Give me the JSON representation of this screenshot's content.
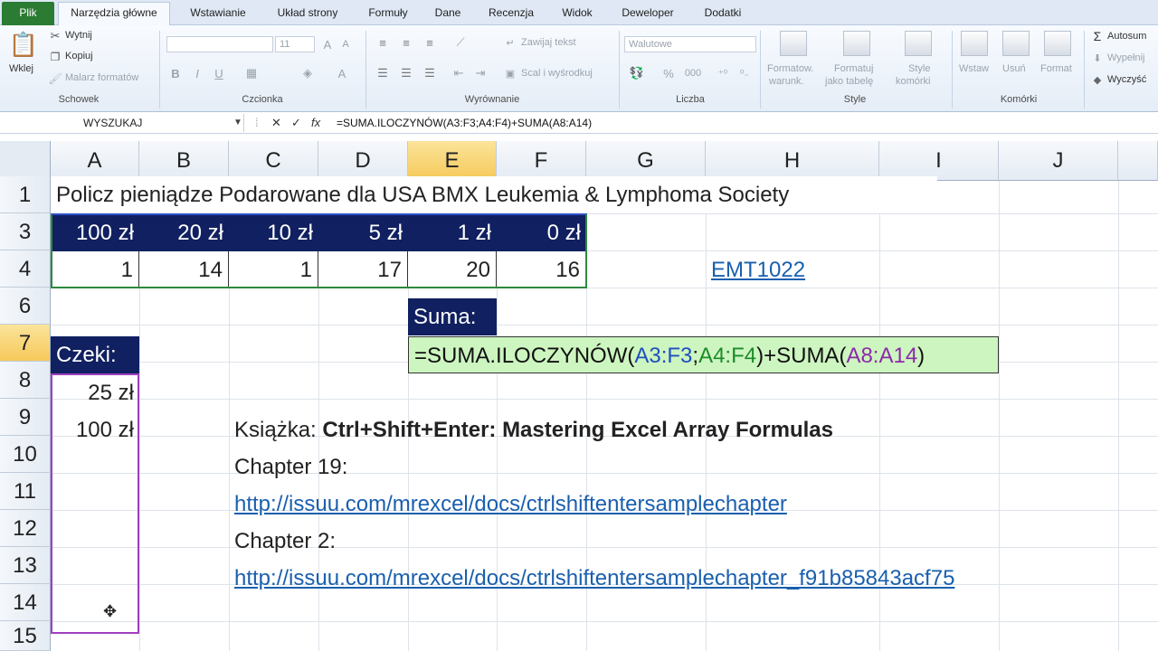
{
  "tabs": [
    "Plik",
    "Narzędzia główne",
    "Wstawianie",
    "Układ strony",
    "Formuły",
    "Dane",
    "Recenzja",
    "Widok",
    "Deweloper",
    "Dodatki"
  ],
  "ribbon": {
    "clipboard": {
      "paste": "Wklej",
      "cut": "Wytnij",
      "copy": "Kopiuj",
      "format_painter": "Malarz formatów",
      "label": "Schowek"
    },
    "font": {
      "size": "11",
      "label": "Czcionka",
      "bold": "B",
      "italic": "I",
      "underline": "U"
    },
    "alignment": {
      "wrap": "Zawijaj tekst",
      "merge": "Scal i wyśrodkuj",
      "label": "Wyrównanie"
    },
    "number": {
      "format": "Walutowe",
      "label": "Liczba",
      "percent": "%",
      "thousands": "000"
    },
    "styles": {
      "cond": "Formatow.",
      "cond2": "warunk.",
      "table": "Formatuj",
      "table2": "jako tabelę",
      "cell": "Style",
      "cell2": "komórki",
      "label": "Style"
    },
    "cells": {
      "insert": "Wstaw",
      "delete": "Usuń",
      "format": "Format",
      "label": "Komórki"
    },
    "editing": {
      "autosum": "Autosum",
      "fill": "Wypełnij",
      "clear": "Wyczyść"
    }
  },
  "formula_bar": {
    "name_box": "WYSZUKAJ",
    "cancel": "✕",
    "enter": "✓",
    "fx": "fx",
    "formula": "=SUMA.ILOCZYNÓW(A3:F3;A4:F4)+SUMA(A8:A14)"
  },
  "columns": [
    "A",
    "B",
    "C",
    "D",
    "E",
    "F",
    "G",
    "H",
    "I",
    "J"
  ],
  "rows": [
    "1",
    "3",
    "4",
    "6",
    "7",
    "8",
    "9",
    "10",
    "11",
    "12",
    "13",
    "14",
    "15"
  ],
  "sheet": {
    "title": "Policz pieniądze Podarowane dla USA BMX Leukemia & Lymphoma Society",
    "denominations": [
      "100 zł",
      "20 zł",
      "10 zł",
      "5 zł",
      "1 zł",
      "0 zł"
    ],
    "counts": [
      "1",
      "14",
      "1",
      "17",
      "20",
      "16"
    ],
    "emt": "EMT1022",
    "suma_label": "Suma:",
    "formula_parts": [
      "=SUMA.ILOCZYNÓW(",
      "A3:F3",
      ";",
      "A4:F4",
      ")+SUMA(",
      "A8:A14",
      ")"
    ],
    "czeki_label": "Czeki:",
    "checks": [
      "25 zł",
      "100 zł"
    ],
    "book_prefix": "Książka: ",
    "book_title": "Ctrl+Shift+Enter: Mastering Excel Array Formulas",
    "chapter19": "Chapter 19:",
    "link1": "http://issuu.com/mrexcel/docs/ctrlshiftentersamplechapter",
    "chapter2": "Chapter 2:",
    "link2": "http://issuu.com/mrexcel/docs/ctrlshiftentersamplechapter_f91b85843acf75"
  },
  "colors": {
    "navy": "#102060",
    "formula_bg": "#cdf5c0",
    "link": "#1a5fae",
    "file_tab": "#2b7b32"
  }
}
